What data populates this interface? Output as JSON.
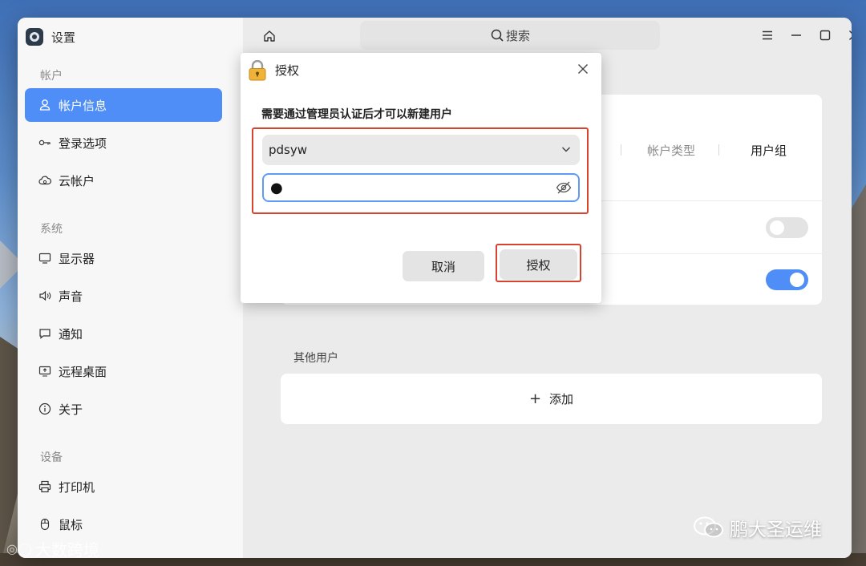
{
  "app": {
    "title": "设置"
  },
  "sidebar": {
    "sections": [
      {
        "label": "帐户"
      },
      {
        "label": "系统"
      },
      {
        "label": "设备"
      }
    ],
    "items": [
      {
        "label": "帐户信息",
        "icon": "user-icon",
        "active": true
      },
      {
        "label": "登录选项",
        "icon": "key-icon"
      },
      {
        "label": "云帐户",
        "icon": "cloud-icon"
      },
      {
        "label": "显示器",
        "icon": "monitor-icon"
      },
      {
        "label": "声音",
        "icon": "speaker-icon"
      },
      {
        "label": "通知",
        "icon": "chat-icon"
      },
      {
        "label": "远程桌面",
        "icon": "remote-desktop-icon"
      },
      {
        "label": "关于",
        "icon": "info-icon"
      },
      {
        "label": "打印机",
        "icon": "printer-icon"
      },
      {
        "label": "鼠标",
        "icon": "mouse-icon"
      }
    ]
  },
  "titlebar": {
    "search_label": "搜索"
  },
  "account": {
    "tabs": [
      {
        "label": "帐户类型"
      },
      {
        "label": "用户组"
      }
    ],
    "toggles": [
      {
        "state": "off"
      },
      {
        "state": "on"
      }
    ]
  },
  "other_users": {
    "section_label": "其他用户",
    "add_label": "添加"
  },
  "dialog": {
    "title": "授权",
    "message": "需要通过管理员认证后才可以新建用户",
    "username": "pdsyw",
    "password_mask": "●",
    "cancel_label": "取消",
    "authorize_label": "授权"
  },
  "watermarks": {
    "left": "大数跨境",
    "right": "鹏大圣运维"
  },
  "colors": {
    "accent": "#4f8ef7",
    "highlight_box": "#d6442f"
  }
}
